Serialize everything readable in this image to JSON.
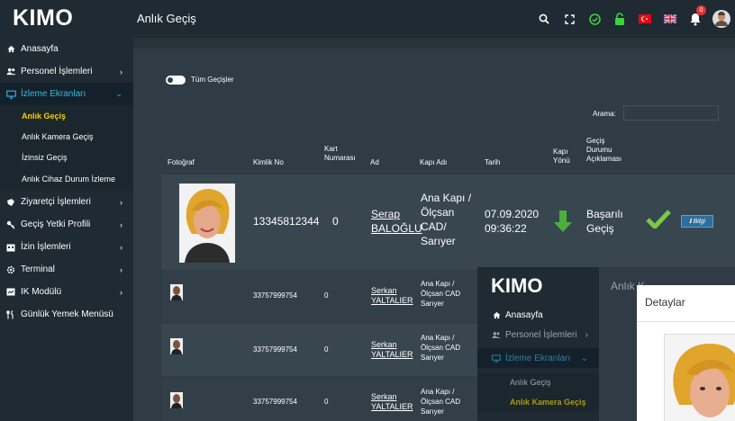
{
  "app": {
    "logo": "KIMO",
    "page_title": "Anlık Geçiş"
  },
  "topbar_icons": [
    "search-icon",
    "fullscreen-icon",
    "status-ok-icon",
    "lock-open-icon",
    "turkish-flag-icon",
    "uk-flag-icon",
    "notification-bell-icon",
    "user-avatar"
  ],
  "notifications": {
    "count": "0"
  },
  "sidebar": {
    "items": [
      {
        "label": "Anasayfa",
        "icon": "home-icon"
      },
      {
        "label": "Personel İşlemleri",
        "icon": "users-icon"
      },
      {
        "label": "İzleme Ekranları",
        "icon": "monitor-icon"
      },
      {
        "label": "Ziyaretçi İşlemleri",
        "icon": "visitor-icon"
      },
      {
        "label": "Geçiş Yetki Profili",
        "icon": "key-icon"
      },
      {
        "label": "İzin İşlemleri",
        "icon": "calendar-icon"
      },
      {
        "label": "Terminal",
        "icon": "gear-icon"
      },
      {
        "label": "IK Modülü",
        "icon": "id-card-icon"
      },
      {
        "label": "Günlük Yemek Menüsü",
        "icon": "utensils-icon"
      }
    ],
    "subitems": [
      {
        "label": "Anlık Geçiş"
      },
      {
        "label": "Anlık Kamera Geçiş"
      },
      {
        "label": "İzinsiz Geçiş"
      },
      {
        "label": "Anlık Cihaz Durum İzleme"
      }
    ]
  },
  "filter": {
    "toggle_label": "Tüm Geçişler"
  },
  "search": {
    "label": "Arama:",
    "value": ""
  },
  "table": {
    "headers": {
      "photo": "Fotoğraf",
      "id": "Kimlik No",
      "card": "Kart Numarası",
      "name": "Ad",
      "door": "Kapı Adı",
      "date": "Tarih",
      "direction": "Kapı Yönü",
      "status": "Geçiş Durumu Açıklaması"
    },
    "rows": [
      {
        "id": "13345812344",
        "card": "0",
        "first": "Serap",
        "last": "BALOĞLU",
        "door": "Ana Kapı / Ölçsan CAD/ Sarıyer",
        "date": "07.09.2020",
        "time": "09:36:22",
        "status1": "Başarılı",
        "status2": "Geçiş",
        "info": "Bilgi"
      },
      {
        "id": "33757999754",
        "card": "0",
        "first": "Serkan",
        "last": "YALTALIER",
        "door": "Ana Kapı / Ölçsan CAD Sarıyer"
      },
      {
        "id": "33757999754",
        "card": "0",
        "first": "Serkan",
        "last": "YALTALIER",
        "door": "Ana Kapı / Ölçsan CAD Sarıyer"
      },
      {
        "id": "33757999754",
        "card": "0",
        "first": "Serkan",
        "last": "YALTALIER",
        "door": "Ana Kapı / Ölçsan CAD Sarıyer"
      }
    ]
  },
  "overlay": {
    "logo": "KIMO",
    "title": "Anlık K",
    "items": [
      {
        "label": "Anasayfa"
      },
      {
        "label": "Personel İşlemleri"
      },
      {
        "label": "İzleme Ekranları"
      }
    ],
    "subitems": [
      {
        "label": "Anlık Geçiş"
      },
      {
        "label": "Anlık Kamera Geçiş"
      }
    ],
    "modal_title": "Detaylar"
  },
  "colors": {
    "sidebar_bg": "#1f2a33",
    "main_bg": "#2f3b45",
    "row_bg": "#384650",
    "accent": "#39b5e8",
    "current": "#f0d000",
    "success": "#6cc644"
  }
}
